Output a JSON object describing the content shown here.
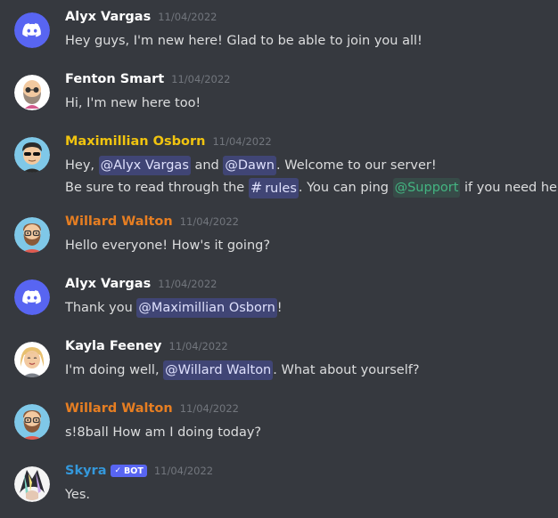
{
  "colors": {
    "background": "#36393f",
    "text": "#dcddde",
    "timestamp": "#72767d",
    "mention_bg": "#414675",
    "role_support": "#43b581",
    "bot_tag": "#5865f2",
    "name_white": "#ffffff",
    "name_gold": "#f1c40f",
    "name_orange": "#e67e22",
    "name_blue": "#3498db"
  },
  "messages": [
    {
      "author": "Alyx Vargas",
      "time": "11/04/2022",
      "name_color": "#ffffff",
      "avatar": "discord-logo-icon",
      "line1": "Hey guys, I'm new here! Glad to be able to join you all!"
    },
    {
      "author": "Fenton Smart",
      "time": "11/04/2022",
      "name_color": "#ffffff",
      "avatar": "bald-bearded-man-avatar",
      "line1": "Hi, I'm new here too!"
    },
    {
      "author": "Maximillian Osborn",
      "time": "11/04/2022",
      "name_color": "#f1c40f",
      "avatar": "sunglasses-man-avatar",
      "line1_prefix": "Hey, ",
      "mention_1": "@Alyx Vargas",
      "line1_middle": " and ",
      "mention_2": "@Dawn",
      "line1_suffix": ". Welcome to our server!",
      "line2_prefix": "Be sure to read through the ",
      "channel_hash": "#",
      "channel_name": "rules",
      "line2_middle": ". You can ping ",
      "role_mention": "@Support",
      "line2_suffix": " if you need help."
    },
    {
      "author": "Willard Walton",
      "time": "11/04/2022",
      "name_color": "#e67e22",
      "avatar": "bearded-glasses-man-avatar",
      "line1": "Hello everyone! How's it going?"
    },
    {
      "author": "Alyx Vargas",
      "time": "11/04/2022",
      "name_color": "#ffffff",
      "avatar": "discord-logo-icon",
      "line1_prefix": "Thank you ",
      "mention_1": "@Maximillian Osborn",
      "line1_suffix": "!"
    },
    {
      "author": "Kayla Feeney",
      "time": "11/04/2022",
      "name_color": "#ffffff",
      "avatar": "blonde-woman-avatar",
      "line1_prefix": "I'm doing well, ",
      "mention_1": "@Willard Walton",
      "line1_suffix": ". What about yourself?"
    },
    {
      "author": "Willard Walton",
      "time": "11/04/2022",
      "name_color": "#e67e22",
      "avatar": "bearded-glasses-man-avatar",
      "line1": "s!8ball How am I doing today?"
    },
    {
      "author": "Skyra",
      "bot_check": "✓",
      "bot_label": "BOT",
      "time": "11/04/2022",
      "name_color": "#3498db",
      "avatar": "skyra-bot-avatar",
      "line1": "Yes."
    }
  ]
}
